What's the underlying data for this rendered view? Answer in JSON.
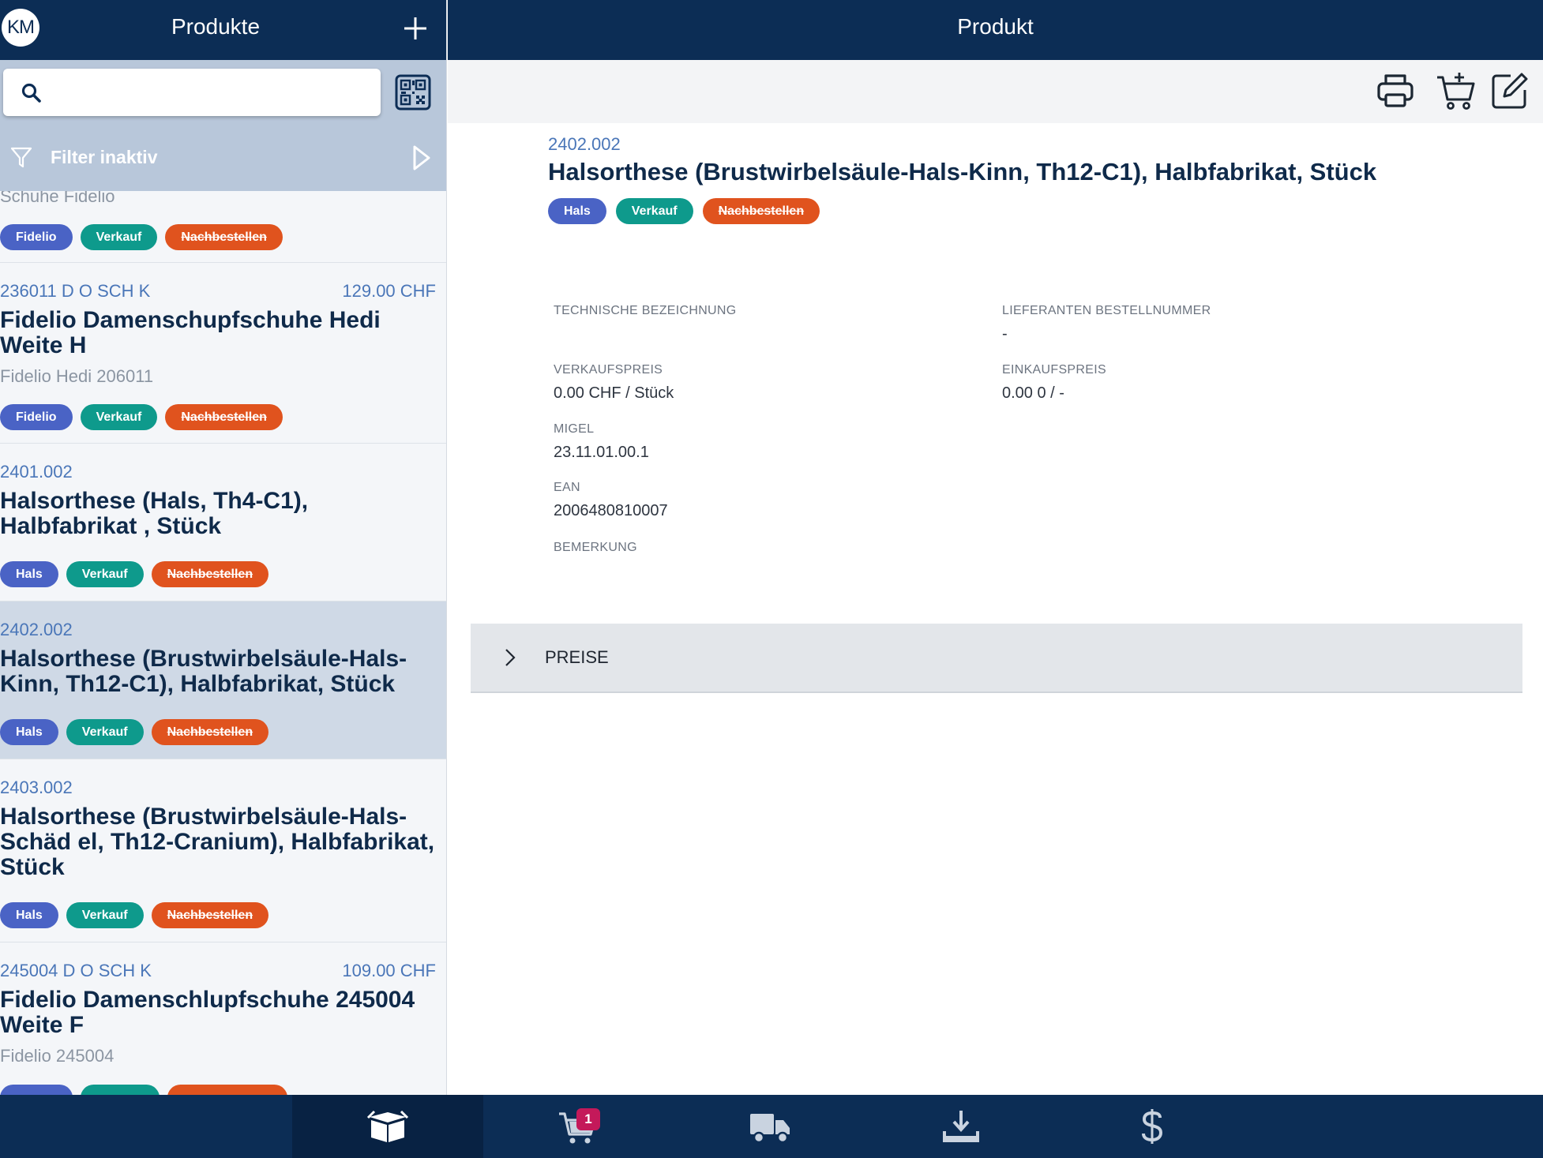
{
  "left_header": {
    "avatar_initials": "KM",
    "title": "Produkte"
  },
  "search": {
    "placeholder": "",
    "value": ""
  },
  "filter": {
    "label": "Filter inaktiv"
  },
  "products": [
    {
      "partial_sub": "Schuhe Fidelio",
      "tags": [
        "Fidelio",
        "Verkauf",
        "Nachbestellen"
      ]
    },
    {
      "code": "236011 D O SCH K",
      "price": "129.00 CHF",
      "name_line1": "Fidelio Damenschupfschuhe Hedi",
      "name_line2": "Weite H",
      "sub": "Fidelio Hedi 206011",
      "tags": [
        "Fidelio",
        "Verkauf",
        "Nachbestellen"
      ]
    },
    {
      "code": "2401.002",
      "name_line1": "Halsorthese (Hals, Th4-C1),",
      "name_line2": "Halbfabrikat , Stück",
      "tags": [
        "Hals",
        "Verkauf",
        "Nachbestellen"
      ]
    },
    {
      "code": "2402.002",
      "name_line1": "Halsorthese (Brustwirbelsäule-Hals-",
      "name_line2": "Kinn, Th12-C1), Halbfabrikat, Stück",
      "tags": [
        "Hals",
        "Verkauf",
        "Nachbestellen"
      ]
    },
    {
      "code": "2403.002",
      "name_line1": "Halsorthese (Brustwirbelsäule-Hals-",
      "name_line2": "Schäd el, Th12-Cranium), Halbfabrikat,",
      "name_line3": "Stück",
      "tags": [
        "Hals",
        "Verkauf",
        "Nachbestellen"
      ]
    },
    {
      "code": "245004 D O SCH K",
      "price": "109.00 CHF",
      "name_line1": "Fidelio Damenschlupfschuhe 245004",
      "name_line2": "Weite F",
      "sub": "Fidelio 245004"
    }
  ],
  "right_header": {
    "title": "Produkt"
  },
  "detail": {
    "code": "2402.002",
    "name": "Halsorthese (Brustwirbelsäule-Hals-Kinn, Th12-C1), Halbfabrikat, Stück",
    "tags": [
      "Hals",
      "Verkauf",
      "Nachbestellen"
    ],
    "fields": {
      "technische_bezeichnung": {
        "label": "TECHNISCHE BEZEICHNUNG",
        "value": ""
      },
      "lieferanten_bestellnummer": {
        "label": "LIEFERANTEN BESTELLNUMMER",
        "value": "-"
      },
      "verkaufspreis": {
        "label": "VERKAUFSPREIS",
        "value": "0.00 CHF / Stück"
      },
      "einkaufspreis": {
        "label": "EINKAUFSPREIS",
        "value": "0.00 0 / -"
      },
      "migel": {
        "label": "MIGEL",
        "value": "23.11.01.00.1"
      },
      "ean": {
        "label": "EAN",
        "value": "2006480810007"
      },
      "bemerkung": {
        "label": "BEMERKUNG",
        "value": ""
      }
    },
    "preise_label": "PREISE"
  },
  "bottom_nav": {
    "cart_badge": "1"
  },
  "colors": {
    "navy": "#0c2d55",
    "tag_blue": "#4a63c5",
    "tag_green": "#0e9a8c",
    "tag_orange": "#e0531e",
    "badge": "#c4195a"
  }
}
